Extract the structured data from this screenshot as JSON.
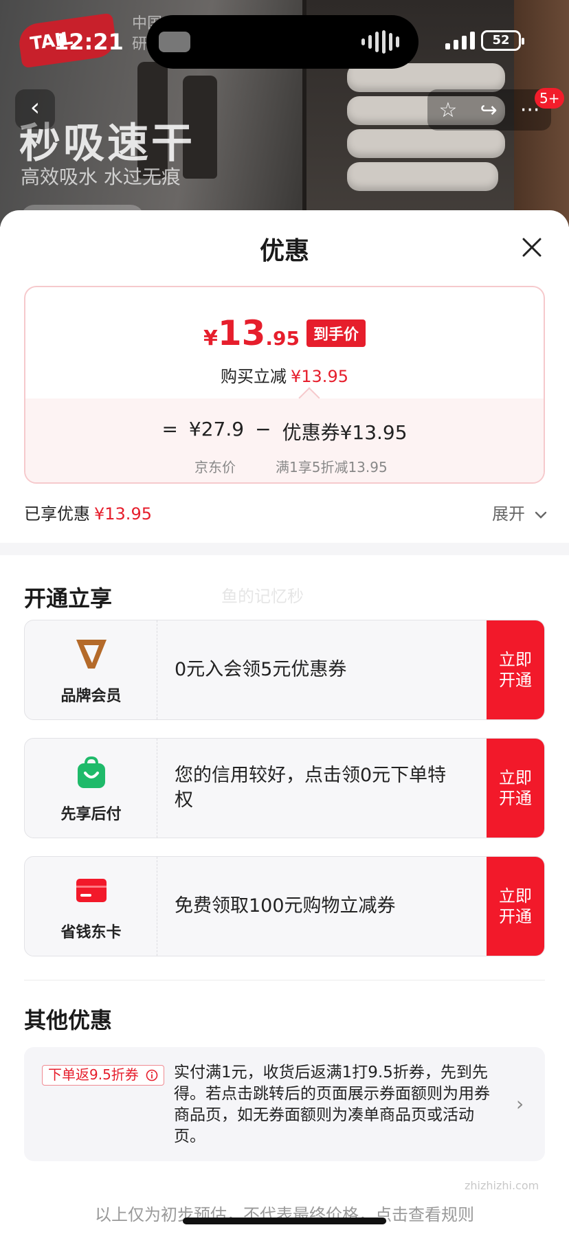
{
  "status": {
    "time": "12:21",
    "battery": "52"
  },
  "hero": {
    "logo_text": "TAIL",
    "brand_small": "中国\n研",
    "title": "秒吸速干",
    "subtitle": "高效吸水 水过无痕"
  },
  "nav": {
    "back_icon": "chevron-left-icon",
    "badge": "5+"
  },
  "sheet": {
    "title": "优惠",
    "final_price": {
      "yen": "¥",
      "int": "13",
      "dec": ".95",
      "tag": "到手价"
    },
    "reduce": {
      "label": "购买立减",
      "value": "¥13.95"
    },
    "formula": {
      "eq": "=",
      "jd_price": "¥27.9",
      "minus": "−",
      "coupon": "优惠券¥13.95",
      "jd_price_label": "京东价",
      "coupon_label": "满1享5折减13.95"
    },
    "enjoyed": {
      "label": "已享优惠",
      "value": "¥13.95"
    },
    "expand": "展开"
  },
  "open_section": {
    "title": "开通立享",
    "watermark": "鱼的记忆秒",
    "items": [
      {
        "name": "品牌会员",
        "desc": "0元入会领5元优惠券",
        "button": "立即开通"
      },
      {
        "name": "先享后付",
        "desc": "您的信用较好，点击领0元下单特权",
        "button": "立即开通"
      },
      {
        "name": "省钱东卡",
        "desc": "免费领取100元购物立减券",
        "button": "立即开通"
      }
    ]
  },
  "other_section": {
    "title": "其他优惠",
    "tag": "下单返9.5折券",
    "text": "实付满1元，收货后返满1打9.5折券，先到先得。若点击跳转后的页面展示券面额则为用券商品页，如无券面额则为凑单商品页或活动页。"
  },
  "footer": "以上仅为初步预估，不代表最终价格，点击查看规则",
  "site_mark": "zhizhizhi.com",
  "colors": {
    "accent": "#e61e2c",
    "button": "#f2192a",
    "member_icon": "#b46a2a",
    "pay_icon": "#1fba6a"
  }
}
